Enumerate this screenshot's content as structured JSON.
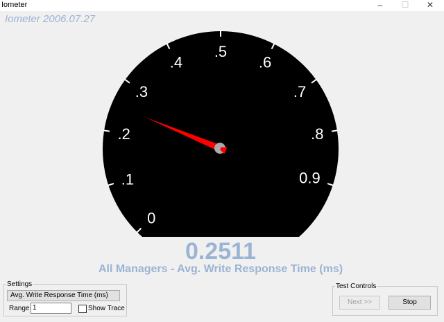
{
  "window": {
    "title": "Iometer",
    "minimize": "–",
    "maximize": "☐",
    "close": "✕"
  },
  "version": "Iometer 2006.07.27",
  "gauge": {
    "min": 0,
    "max": 1,
    "value": 0.2511,
    "tick_labels": [
      "0",
      ".1",
      ".2",
      ".3",
      ".4",
      ".5",
      ".6",
      ".7",
      ".8",
      "0.9"
    ],
    "needle_color": "#ff0000",
    "dial_color": "#000000"
  },
  "readout": {
    "value": "0.2511",
    "subtitle": "All Managers - Avg. Write Response Time (ms)"
  },
  "settings": {
    "legend": "Settings",
    "metric_button": "Avg. Write Response Time (ms)",
    "range_label": "Range",
    "range_value": "1",
    "show_trace_label": "Show Trace",
    "show_trace_checked": false
  },
  "test_controls": {
    "legend": "Test Controls",
    "next": "Next >>",
    "stop": "Stop"
  }
}
